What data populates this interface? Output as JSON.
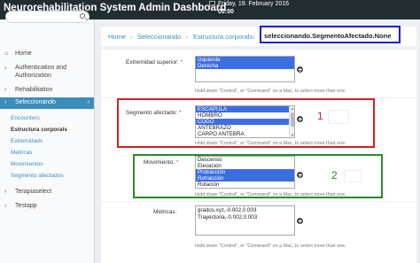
{
  "header": {
    "title": "Neurorehabilitation System Admin Dashboard",
    "date": "Friday, 19. February 2016",
    "time": "00:00"
  },
  "sidebar": {
    "items": [
      {
        "label": "Home",
        "icon": "home-icon"
      },
      {
        "label": "Authentication and Authorization",
        "icon": "chevron-right-icon"
      },
      {
        "label": "Rehabilitation",
        "icon": "chevron-right-icon"
      },
      {
        "label": "Seleccionando",
        "icon": "chevron-down-icon"
      },
      {
        "label": "Terapiaselect",
        "icon": "chevron-right-icon"
      },
      {
        "label": "Testapp",
        "icon": "chevron-right-icon"
      }
    ],
    "subitems": [
      "Encounters",
      "Estructura corporals",
      "Extremidads",
      "Metricas",
      "Movimientos",
      "Segmento afectados"
    ]
  },
  "breadcrumb": {
    "items": [
      "Home",
      "Seleccionando",
      "Estructura corporals"
    ],
    "current": "seleccionando.SegmentoAfectado.None"
  },
  "form": {
    "help_text": "Hold down \"Control\", or \"Command\" on a Mac, to select more than one.",
    "extremidad": {
      "label": "Extremidad superior:",
      "options": [
        {
          "text": "Izquierda",
          "selected": true
        },
        {
          "text": "Derecha",
          "selected": true
        }
      ]
    },
    "segmento": {
      "label": "Segmento afectado:",
      "options": [
        {
          "text": "ESCAPULA",
          "selected": true
        },
        {
          "text": "HOMBRO",
          "selected": false
        },
        {
          "text": "CODO",
          "selected": true
        },
        {
          "text": "ANTEBRAZO",
          "selected": false
        },
        {
          "text": "CARPO ANTEBRA",
          "selected": false
        }
      ],
      "annotation": "1"
    },
    "movimiento": {
      "label": "Movimiento:",
      "options": [
        {
          "text": "Descenso",
          "selected": false
        },
        {
          "text": "Elevación",
          "selected": false
        },
        {
          "text": "Protracción",
          "selected": true
        },
        {
          "text": "Retracción",
          "selected": true
        },
        {
          "text": "Rotación",
          "selected": false
        }
      ],
      "annotation": "2"
    },
    "metricas": {
      "label": "Metricas:",
      "lines": [
        "grados.xyz,-0.002,0.003",
        "Trayectoria,-0.002,0.003"
      ]
    }
  },
  "colors": {
    "header_bg": "#222d32",
    "accent": "#3c8dbc",
    "selected_option": "#3c6ee0",
    "annotation_red": "#d42020",
    "annotation_green": "#2a8a2a",
    "annotation_blue": "#1a1ad8"
  }
}
